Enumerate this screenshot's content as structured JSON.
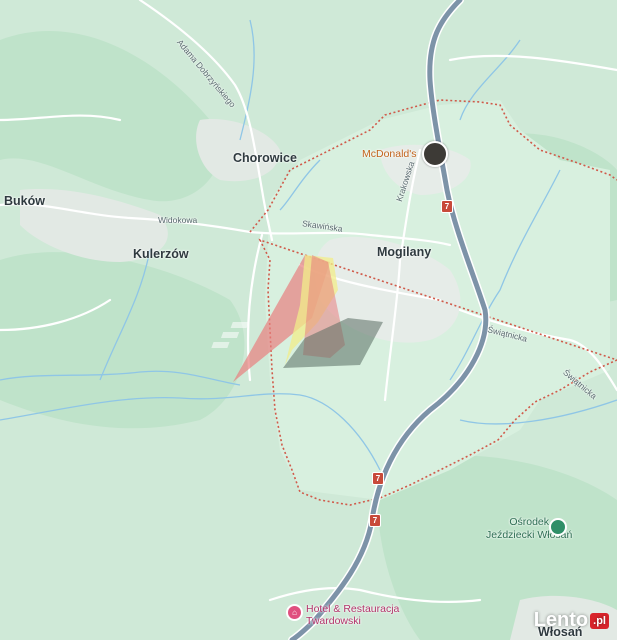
{
  "map": {
    "towns": {
      "chorowice": "Chorowice",
      "bukow": "Buków",
      "kulerzow": "Kulerzów",
      "mogilany": "Mogilany",
      "wlosan": "Włosań"
    },
    "streets": {
      "adama": "Adama Dobrzyńskiego",
      "widokowa": "Widokowa",
      "skawinska": "Skawińska",
      "krakowska": "Krakowska",
      "swiatnicka_1": "Świątnicka",
      "swiatnicka_2": "Świątnicka"
    },
    "road_number": "7",
    "pois": {
      "mcdonalds": "McDonald's",
      "osrodek_line1": "Ośrodek",
      "osrodek_line2": "Jeździecki Włosań",
      "hotel_line1": "Hotel & Restauracja",
      "hotel_line2": "Twardowski"
    },
    "colors": {
      "background": "#cfe9d7",
      "forest": "#b7e0c3",
      "road_primary": "#7d93a8",
      "boundary": "#d05a4a",
      "overlay_red": "#e87f7f",
      "overlay_yellow": "#f2ee8a",
      "overlay_dark": "#5a6e62"
    },
    "icons": [
      "restaurant-photo-icon",
      "horse-riding-icon",
      "hotel-icon"
    ]
  },
  "watermark": {
    "text": "Lento",
    "suffix": ".pl"
  }
}
